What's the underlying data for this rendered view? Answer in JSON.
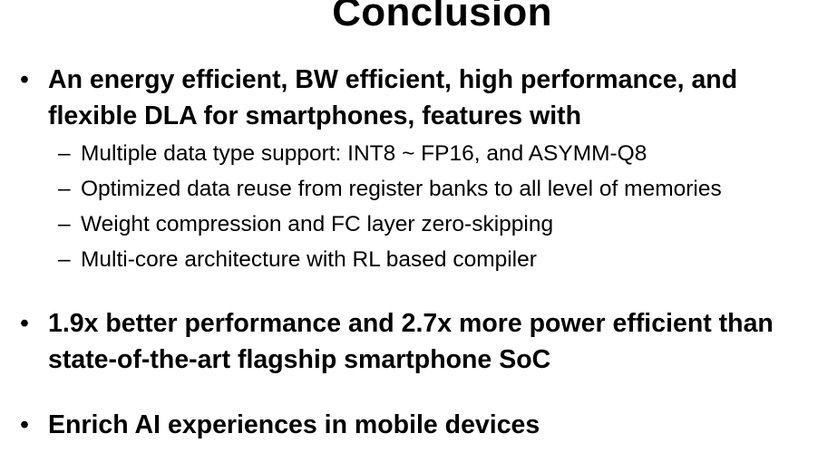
{
  "slide": {
    "title": "Conclusion",
    "bullet_symbol": "•",
    "dash_symbol": "–",
    "bullets": [
      {
        "text": "An energy efficient, BW efficient, high performance, and flexible DLA for smartphones, features with",
        "subitems": [
          "Multiple data type support: INT8 ~ FP16, and ASYMM-Q8",
          "Optimized data reuse from register banks to all level of memories",
          "Weight compression and FC layer zero-skipping",
          "Multi-core architecture with RL based compiler"
        ]
      },
      {
        "text": "1.9x better performance and 2.7x more power efficient than state-of-the-art flagship smartphone SoC"
      },
      {
        "text": "Enrich AI experiences in mobile devices"
      }
    ]
  }
}
